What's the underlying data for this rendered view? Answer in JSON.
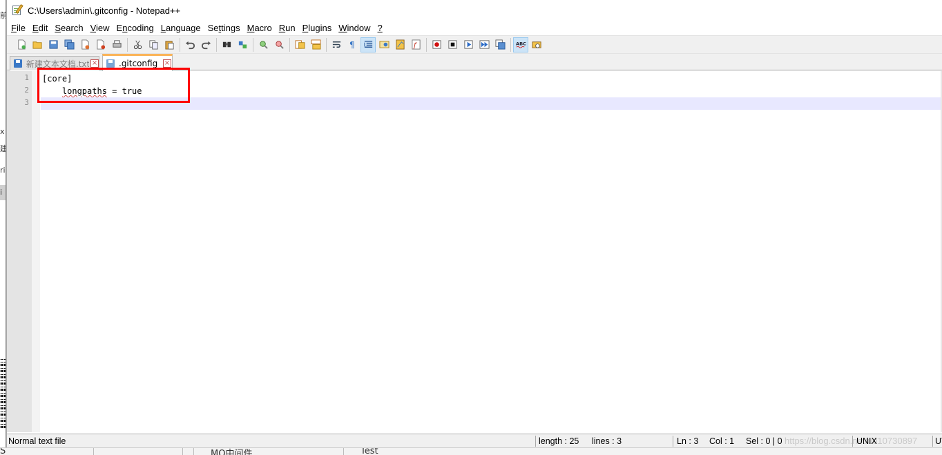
{
  "window": {
    "title": "C:\\Users\\admin\\.gitconfig - Notepad++"
  },
  "menu": [
    {
      "pre": "",
      "u": "F",
      "post": "ile"
    },
    {
      "pre": "",
      "u": "E",
      "post": "dit"
    },
    {
      "pre": "",
      "u": "S",
      "post": "earch"
    },
    {
      "pre": "",
      "u": "V",
      "post": "iew"
    },
    {
      "pre": "E",
      "u": "n",
      "post": "coding"
    },
    {
      "pre": "",
      "u": "L",
      "post": "anguage"
    },
    {
      "pre": "Se",
      "u": "t",
      "post": "tings"
    },
    {
      "pre": "",
      "u": "M",
      "post": "acro"
    },
    {
      "pre": "",
      "u": "R",
      "post": "un"
    },
    {
      "pre": "",
      "u": "P",
      "post": "lugins"
    },
    {
      "pre": "",
      "u": "W",
      "post": "indow"
    },
    {
      "pre": "",
      "u": "?",
      "post": ""
    }
  ],
  "toolbar_icons": [
    "new-file-icon",
    "open-file-icon",
    "save-icon",
    "save-all-icon",
    "close-icon",
    "close-all-icon",
    "print-icon",
    "|",
    "cut-icon",
    "copy-icon",
    "paste-icon",
    "|",
    "undo-icon",
    "redo-icon",
    "|",
    "find-icon",
    "replace-icon",
    "|",
    "zoom-in-icon",
    "zoom-out-icon",
    "|",
    "sync-vertical-icon",
    "sync-horizontal-icon",
    "|",
    "word-wrap-icon",
    "show-all-chars-icon",
    "indent-guide-icon",
    "user-language-icon",
    "doc-map-icon",
    "function-list-icon",
    "|",
    "record-macro-icon",
    "stop-macro-icon",
    "play-macro-icon",
    "run-macro-multiple-icon",
    "save-macro-icon",
    "|",
    "spellcheck-icon",
    "spellcheck-options-icon"
  ],
  "tabs": [
    {
      "label": "新建文本文档.txt",
      "state": "inactive"
    },
    {
      "label": ".gitconfig",
      "state": "active"
    }
  ],
  "editor": {
    "line_numbers": [
      "1",
      "2",
      "3"
    ],
    "lines": [
      {
        "pre": "[core]",
        "sq": "",
        "post": ""
      },
      {
        "pre": "    ",
        "sq": "longpaths",
        "post": " = true"
      },
      {
        "pre": "",
        "sq": "",
        "post": ""
      }
    ],
    "current_line": 3
  },
  "status": {
    "file_type": "Normal text file",
    "length": "length : 25",
    "lines": "lines : 3",
    "ln": "Ln : 3",
    "col": "Col : 1",
    "sel": "Sel : 0 | 0",
    "eol": "UNIX",
    "encoding": "UT",
    "watermark": "https://blog.csdn.net/u010730897"
  },
  "background": {
    "left_fragments": [
      "前",
      "x",
      "建",
      "ri",
      "i"
    ],
    "bottom_fragments": [
      "S",
      "MQ中间件",
      "Test"
    ]
  },
  "colors": {
    "highlight_box": "#ff0000",
    "active_tab_accent": "#fab45a",
    "current_line": "#e8e8ff"
  }
}
